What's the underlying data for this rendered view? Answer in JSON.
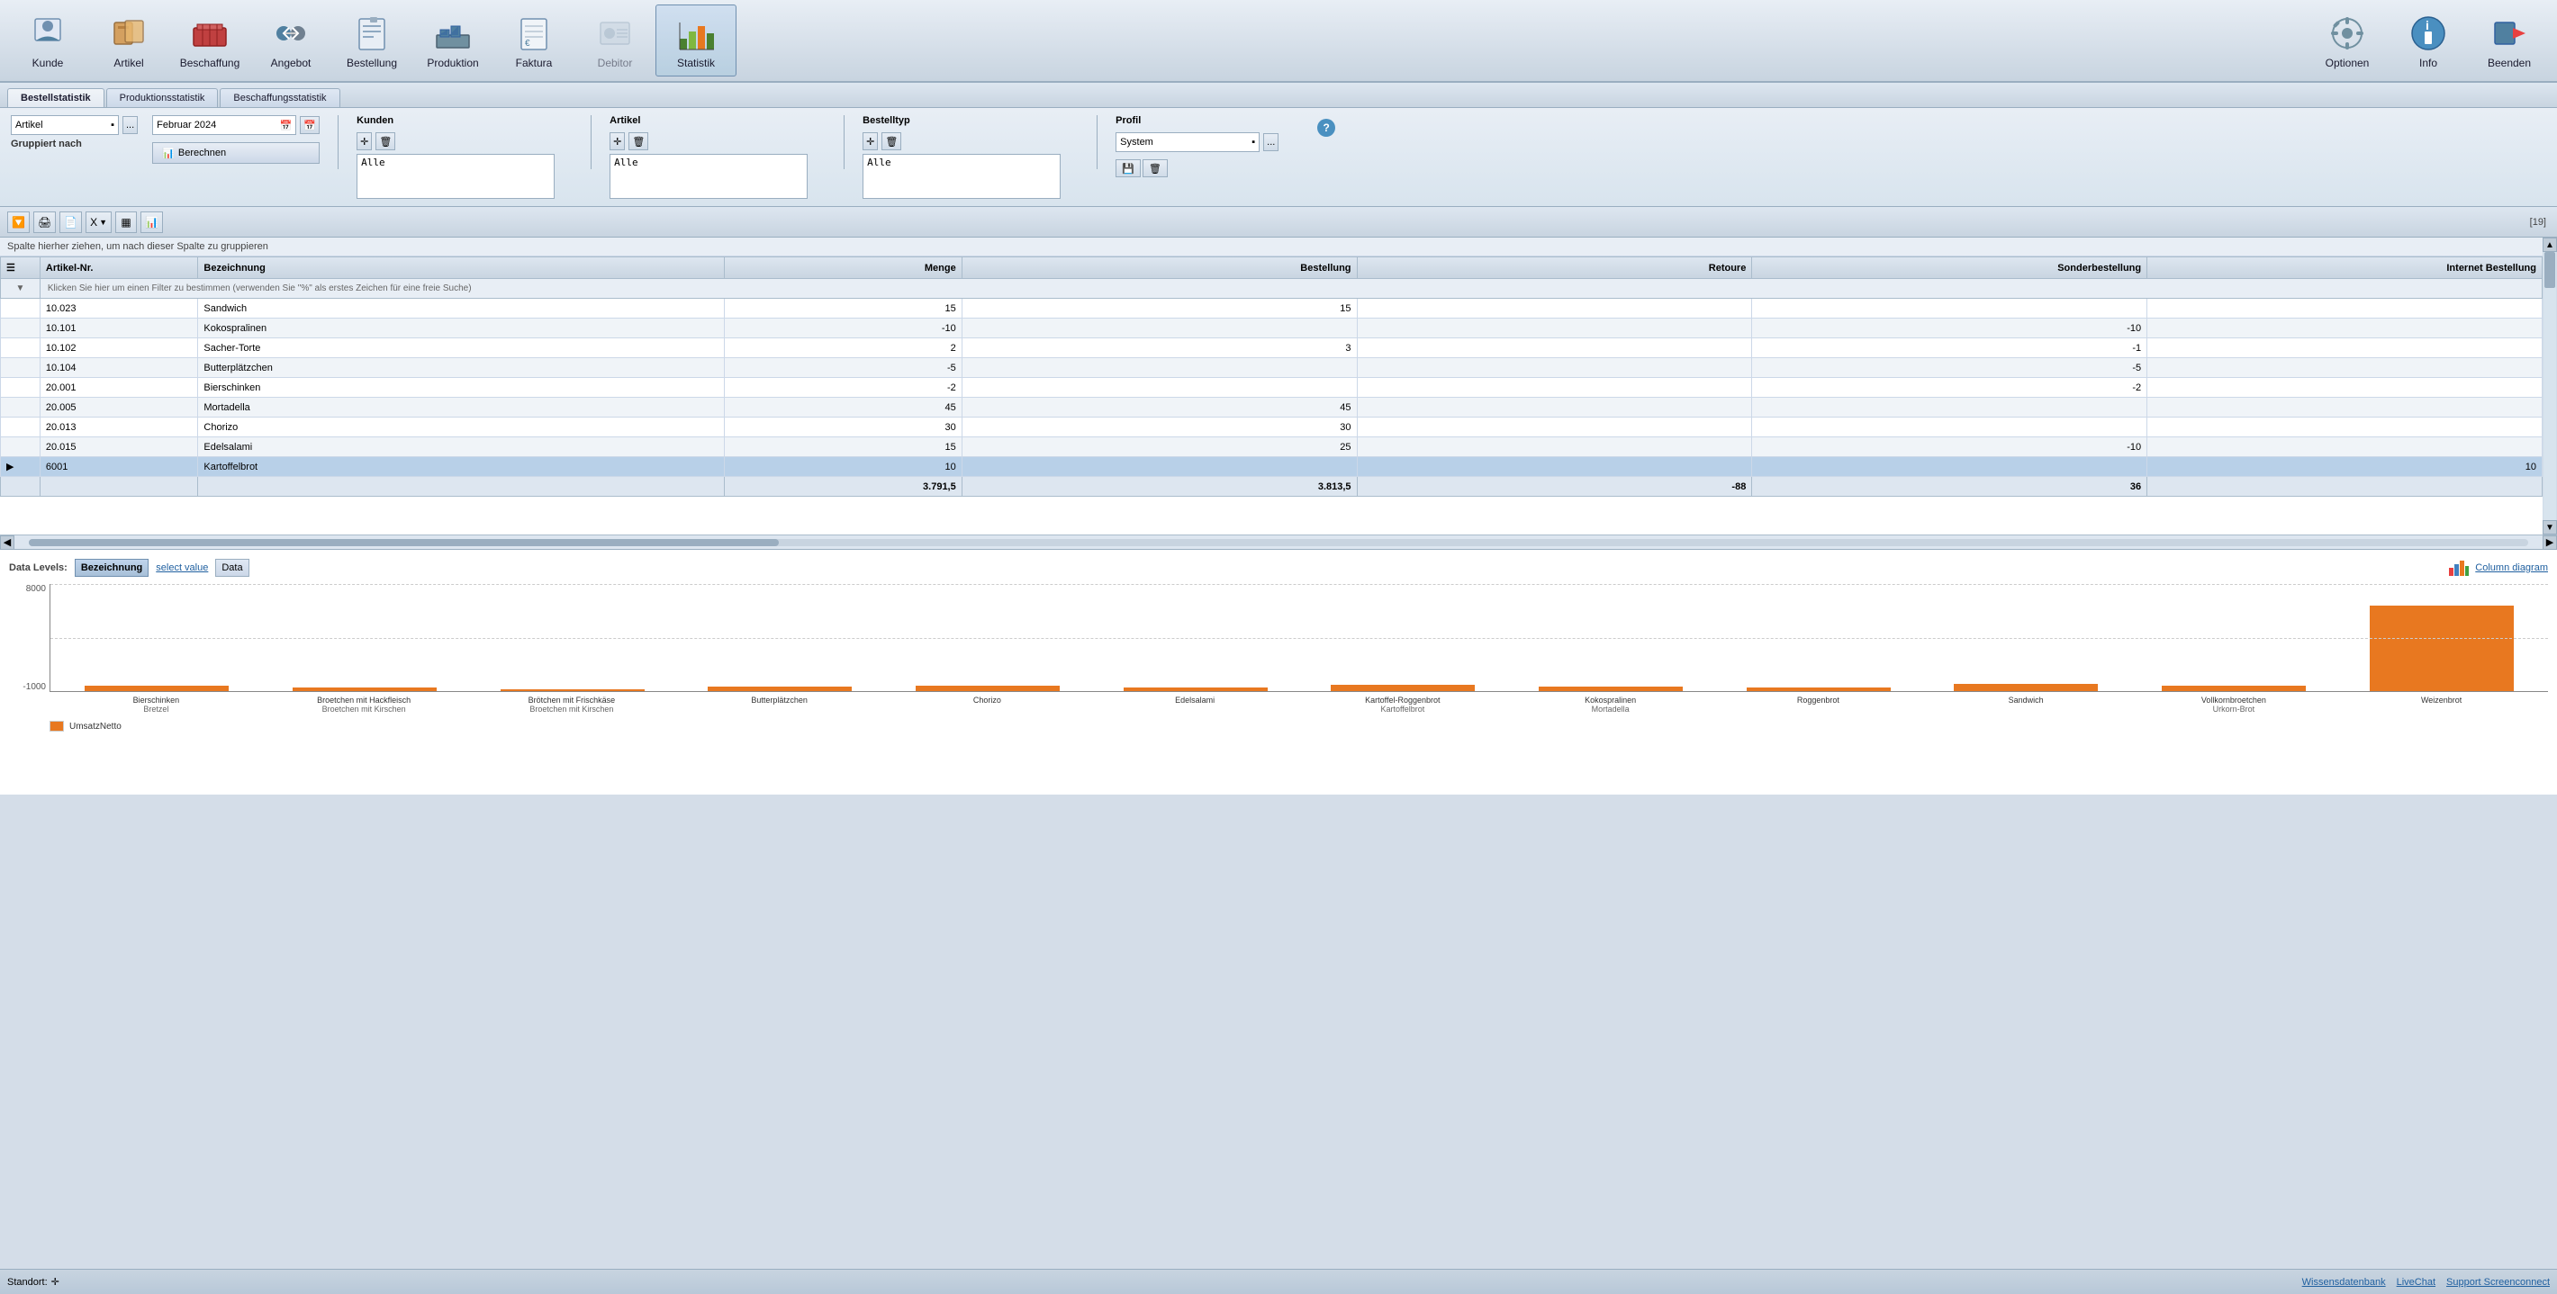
{
  "toolbar": {
    "items": [
      {
        "id": "kunde",
        "label": "Kunde",
        "icon": "person"
      },
      {
        "id": "artikel",
        "label": "Artikel",
        "icon": "box"
      },
      {
        "id": "beschaffung",
        "label": "Beschaffung",
        "icon": "cart"
      },
      {
        "id": "angebot",
        "label": "Angebot",
        "icon": "handshake"
      },
      {
        "id": "bestellung",
        "label": "Bestellung",
        "icon": "document"
      },
      {
        "id": "produktion",
        "label": "Produktion",
        "icon": "factory"
      },
      {
        "id": "faktura",
        "label": "Faktura",
        "icon": "invoice"
      },
      {
        "id": "debitor",
        "label": "Debitor",
        "icon": "debitor",
        "disabled": true
      },
      {
        "id": "statistik",
        "label": "Statistik",
        "icon": "chart",
        "active": true
      }
    ],
    "right": [
      {
        "id": "optionen",
        "label": "Optionen",
        "icon": "gear"
      },
      {
        "id": "info",
        "label": "Info",
        "icon": "info"
      },
      {
        "id": "beenden",
        "label": "Beenden",
        "icon": "exit"
      }
    ]
  },
  "tabs": [
    {
      "id": "bestellstatistik",
      "label": "Bestellstatistik",
      "active": true
    },
    {
      "id": "produktionsstatistik",
      "label": "Produktionsstatistik"
    },
    {
      "id": "beschaffungsstatistik",
      "label": "Beschaffungsstatistik"
    }
  ],
  "filter": {
    "gruppiert_nach_label": "Gruppiert nach",
    "artikel_label": "Artikel",
    "datum_label": "Februar 2024",
    "kunden_label": "Kunden",
    "kunden_value": "Alle",
    "artikel_label2": "Artikel",
    "artikel_value": "Alle",
    "bestelltyp_label": "Bestelltyp",
    "bestelltyp_value": "Alle",
    "profil_label": "Profil",
    "profil_value": "System",
    "berechnen_label": "Berechnen"
  },
  "toolbar2": {
    "count": "[19]"
  },
  "grid": {
    "group_hint": "Spalte hierher ziehen, um nach dieser Spalte zu gruppieren",
    "filter_hint": "Klicken Sie hier um einen Filter zu bestimmen (verwenden Sie \"%\" als erstes Zeichen für eine freie Suche)",
    "columns": [
      {
        "id": "artikel_nr",
        "label": "Artikel-Nr."
      },
      {
        "id": "bezeichnung",
        "label": "Bezeichnung"
      },
      {
        "id": "menge",
        "label": "Menge",
        "align": "right"
      },
      {
        "id": "bestellung",
        "label": "Bestellung",
        "align": "right"
      },
      {
        "id": "retoure",
        "label": "Retoure",
        "align": "right"
      },
      {
        "id": "sonderbestellung",
        "label": "Sonderbestellung",
        "align": "right"
      },
      {
        "id": "internet_bestellung",
        "label": "Internet Bestellung",
        "align": "right"
      }
    ],
    "rows": [
      {
        "artikel_nr": "10.023",
        "bezeichnung": "Sandwich",
        "menge": "15",
        "bestellung": "15",
        "retoure": "",
        "sonderbestellung": "",
        "internet_bestellung": "",
        "selected": false
      },
      {
        "artikel_nr": "10.101",
        "bezeichnung": "Kokospralinen",
        "menge": "-10",
        "bestellung": "",
        "retoure": "",
        "sonderbestellung": "-10",
        "internet_bestellung": "",
        "selected": false
      },
      {
        "artikel_nr": "10.102",
        "bezeichnung": "Sacher-Torte",
        "menge": "2",
        "bestellung": "3",
        "retoure": "",
        "sonderbestellung": "-1",
        "internet_bestellung": "",
        "selected": false
      },
      {
        "artikel_nr": "10.104",
        "bezeichnung": "Butterplätzchen",
        "menge": "-5",
        "bestellung": "",
        "retoure": "",
        "sonderbestellung": "-5",
        "internet_bestellung": "",
        "selected": false
      },
      {
        "artikel_nr": "20.001",
        "bezeichnung": "Bierschinken",
        "menge": "-2",
        "bestellung": "",
        "retoure": "",
        "sonderbestellung": "-2",
        "internet_bestellung": "",
        "selected": false
      },
      {
        "artikel_nr": "20.005",
        "bezeichnung": "Mortadella",
        "menge": "45",
        "bestellung": "45",
        "retoure": "",
        "sonderbestellung": "",
        "internet_bestellung": "",
        "selected": false
      },
      {
        "artikel_nr": "20.013",
        "bezeichnung": "Chorizo",
        "menge": "30",
        "bestellung": "30",
        "retoure": "",
        "sonderbestellung": "",
        "internet_bestellung": "",
        "selected": false
      },
      {
        "artikel_nr": "20.015",
        "bezeichnung": "Edelsalami",
        "menge": "15",
        "bestellung": "25",
        "retoure": "",
        "sonderbestellung": "-10",
        "internet_bestellung": "",
        "selected": false
      },
      {
        "artikel_nr": "6001",
        "bezeichnung": "Kartoffelbrot",
        "menge": "10",
        "bestellung": "",
        "retoure": "",
        "sonderbestellung": "",
        "internet_bestellung": "10",
        "selected": true
      }
    ],
    "totals": {
      "menge": "3.791,5",
      "bestellung": "3.813,5",
      "retoure": "-88",
      "sonderbestellung": "36",
      "internet_bestellung": ""
    }
  },
  "chart": {
    "data_levels_label": "Data Levels:",
    "btn_bezeichnung": "Bezeichnung",
    "btn_select_value": "select value",
    "btn_data": "Data",
    "column_diagram_label": "Column diagram",
    "y_axis_top": "8000",
    "y_axis_bottom": "-1000",
    "bars": [
      {
        "label": "Bierschinken",
        "sublabel": "Bretzel",
        "height_pct": 5,
        "negative": true
      },
      {
        "label": "Broetchen mit Hackfleisch",
        "sublabel": "Broetchen mit Kirschen",
        "height_pct": 3,
        "negative": false
      },
      {
        "label": "Brötchen mit Frischkäse",
        "sublabel": "Broetchen mit Kirschen",
        "height_pct": 2,
        "negative": false
      },
      {
        "label": "Butterplätzchen",
        "sublabel": "",
        "height_pct": 4,
        "negative": false
      },
      {
        "label": "Chorizo",
        "sublabel": "",
        "height_pct": 5,
        "negative": false
      },
      {
        "label": "Edelsalami",
        "sublabel": "",
        "height_pct": 3,
        "negative": false
      },
      {
        "label": "Kartoffel-Roggenbrot",
        "sublabel": "Kartoffelbrot",
        "height_pct": 6,
        "negative": false
      },
      {
        "label": "Kokospralinen",
        "sublabel": "Mortadella",
        "height_pct": 4,
        "negative": false
      },
      {
        "label": "Roggenbrot",
        "sublabel": "",
        "height_pct": 3,
        "negative": false
      },
      {
        "label": "Sandwich",
        "sublabel": "",
        "height_pct": 7,
        "negative": false
      },
      {
        "label": "Vollkornbroetchen",
        "sublabel": "Urkorn-Brot",
        "height_pct": 5,
        "negative": false
      },
      {
        "label": "Weizenbrot",
        "sublabel": "",
        "height_pct": 80,
        "negative": false
      }
    ],
    "legend_label": "UmsatzNetto"
  },
  "status_bar": {
    "standort_label": "Standort:",
    "links": [
      {
        "label": "Wissensdatenbank"
      },
      {
        "label": "LiveChat"
      },
      {
        "label": "Support Screenconnect"
      }
    ]
  }
}
